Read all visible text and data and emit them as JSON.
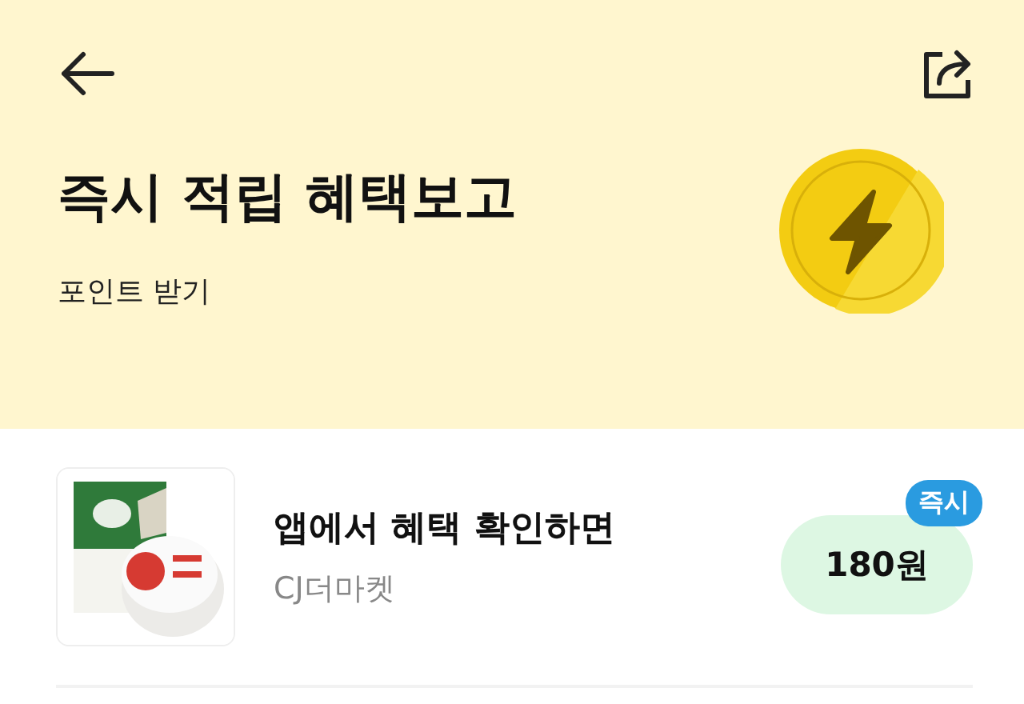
{
  "header": {
    "title": "즉시 적립 혜택보고",
    "subtitle": "포인트 받기"
  },
  "offers": [
    {
      "kind": "picture",
      "title": "앱에서 혜택 확인하면",
      "brand": "CJ더마켓",
      "reward": "180원",
      "badge": "즉시"
    }
  ]
}
